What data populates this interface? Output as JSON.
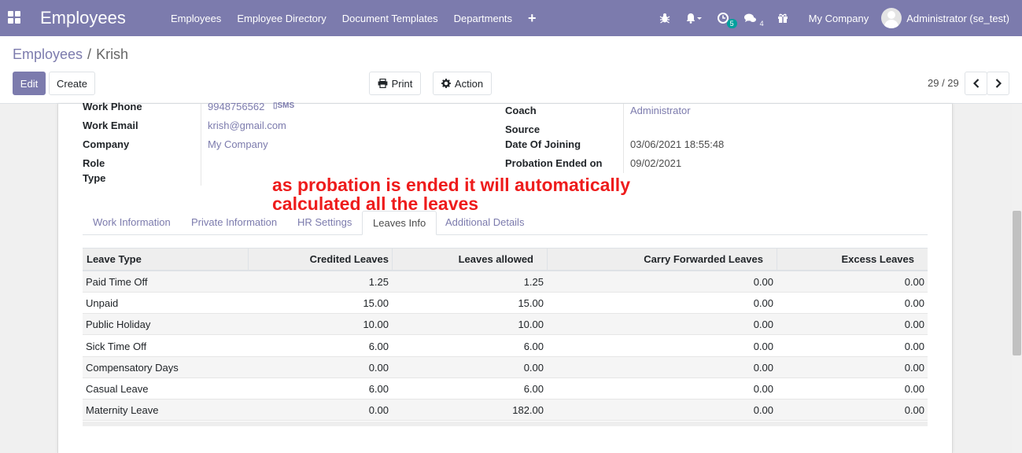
{
  "navbar": {
    "app_title": "Employees",
    "menu": [
      "Employees",
      "Employee Directory",
      "Document Templates",
      "Departments"
    ],
    "plus_label": "+",
    "activity_badge": "5",
    "messages_badge": "4",
    "company": "My Company",
    "user": "Administrator (se_test)"
  },
  "breadcrumb": {
    "parent": "Employees",
    "separator": "/",
    "current": "Krish"
  },
  "buttons": {
    "edit": "Edit",
    "create": "Create",
    "print": "Print",
    "action": "Action"
  },
  "pager": {
    "value": "29 / 29"
  },
  "form": {
    "left": [
      {
        "label": "Work Phone",
        "value": "9948756562"
      },
      {
        "label": "Work Email",
        "value": "krish@gmail.com"
      },
      {
        "label": "Company",
        "value": "My Company"
      },
      {
        "label": "Role",
        "value": ""
      },
      {
        "label": "Type",
        "value": ""
      }
    ],
    "sms_label": "SMS",
    "right": [
      {
        "label": "Coach",
        "value": "Administrator"
      },
      {
        "label": "Source",
        "value": ""
      },
      {
        "label": "Date Of Joining",
        "value": "03/06/2021 18:55:48"
      },
      {
        "label": "Probation Ended on",
        "value": "09/02/2021"
      }
    ]
  },
  "annotation": {
    "line1": "as probation is ended it will automatically",
    "line2": "calculated all the leaves"
  },
  "tabs": [
    "Work Information",
    "Private Information",
    "HR Settings",
    "Leaves Info",
    "Additional Details"
  ],
  "active_tab": "Leaves Info",
  "table": {
    "headers": [
      "Leave Type",
      "Credited Leaves",
      "Leaves allowed",
      "Carry Forwarded Leaves",
      "Excess Leaves"
    ],
    "rows": [
      [
        "Paid Time Off",
        "1.25",
        "1.25",
        "0.00",
        "0.00"
      ],
      [
        "Unpaid",
        "15.00",
        "15.00",
        "0.00",
        "0.00"
      ],
      [
        "Public Holiday",
        "10.00",
        "10.00",
        "0.00",
        "0.00"
      ],
      [
        "Sick Time Off",
        "6.00",
        "6.00",
        "0.00",
        "0.00"
      ],
      [
        "Compensatory Days",
        "0.00",
        "0.00",
        "0.00",
        "0.00"
      ],
      [
        "Casual Leave",
        "6.00",
        "6.00",
        "0.00",
        "0.00"
      ],
      [
        "Maternity Leave",
        "0.00",
        "182.00",
        "0.00",
        "0.00"
      ]
    ]
  },
  "colors": {
    "brand": "#7c7bad",
    "annotation": "#ee1c1c",
    "badge": "#00a09d"
  }
}
